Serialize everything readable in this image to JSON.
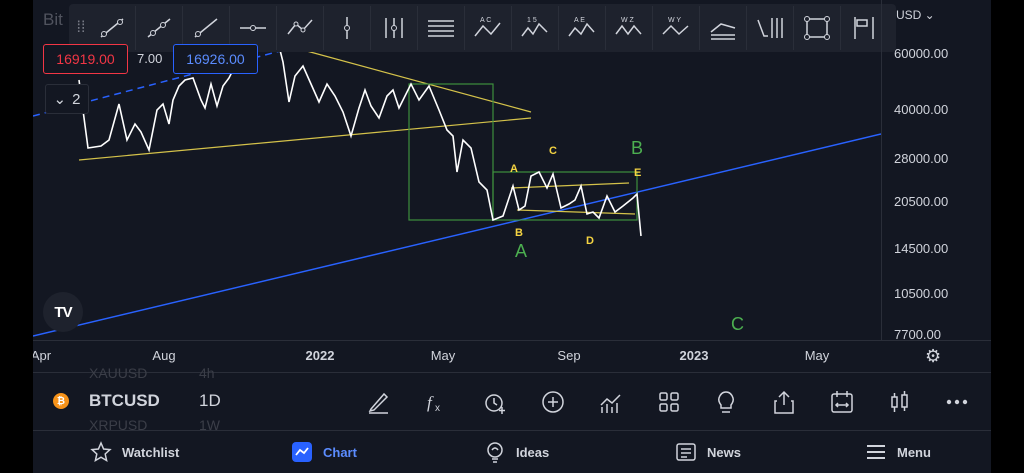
{
  "chart": {
    "symbol_ghost": "Bit",
    "sell_price": "16919.00",
    "spread": "7.00",
    "buy_price": "16926.00",
    "collapse_count": "2",
    "currency": "USD",
    "price_labels": [
      "60000.00",
      "40000.00",
      "28000.00",
      "20500.00",
      "14500.00",
      "10500.00",
      "7700.00"
    ],
    "time_labels": [
      "Apr",
      "Aug",
      "2022",
      "May",
      "Sep",
      "2023",
      "May"
    ],
    "wave_labels_green": [
      "B",
      "A",
      "C"
    ],
    "wave_labels_yellow": [
      "A",
      "C",
      "E",
      "B",
      "D"
    ],
    "logo_text": "TV"
  },
  "symbol_bar": {
    "ghost_top_symbol": "XAUUSD",
    "ghost_top_interval": "4h",
    "ghost_bottom_symbol": "XRPUSD",
    "ghost_bottom_interval": "1W",
    "symbol": "BTCUSD",
    "interval": "1D"
  },
  "nav": {
    "watchlist": "Watchlist",
    "chart": "Chart",
    "ideas": "Ideas",
    "news": "News",
    "menu": "Menu"
  },
  "colors": {
    "background": "#131722",
    "accent": "#2962ff",
    "sell": "#f23645",
    "trendline_yellow": "#d4c24a",
    "box_green": "#3e8f3e",
    "wave_green": "#4caf50",
    "wave_yellow": "#f5d442"
  },
  "icons": [
    "grip-icon",
    "trend-line-icon",
    "ray-icon",
    "extended-line-icon",
    "horizontal-ray-icon",
    "path-icon",
    "vertical-line-icon",
    "pitchfork-icon",
    "parallel-channel-icon",
    "abcd-pattern-icon",
    "wave-15-icon",
    "ae-pattern-icon",
    "wz-pattern-icon",
    "wy-pattern-icon",
    "fib-icon",
    "cycle-icon",
    "rectangle-icon",
    "long-position-icon",
    "pencil-icon",
    "indicators-icon",
    "alert-icon",
    "add-icon",
    "compare-icon",
    "layout-icon",
    "lightbulb-icon",
    "share-icon",
    "replay-icon",
    "candle-icon",
    "more-icon",
    "star-icon",
    "chart-icon",
    "ideas-icon",
    "news-icon",
    "menu-icon",
    "gear-icon"
  ]
}
